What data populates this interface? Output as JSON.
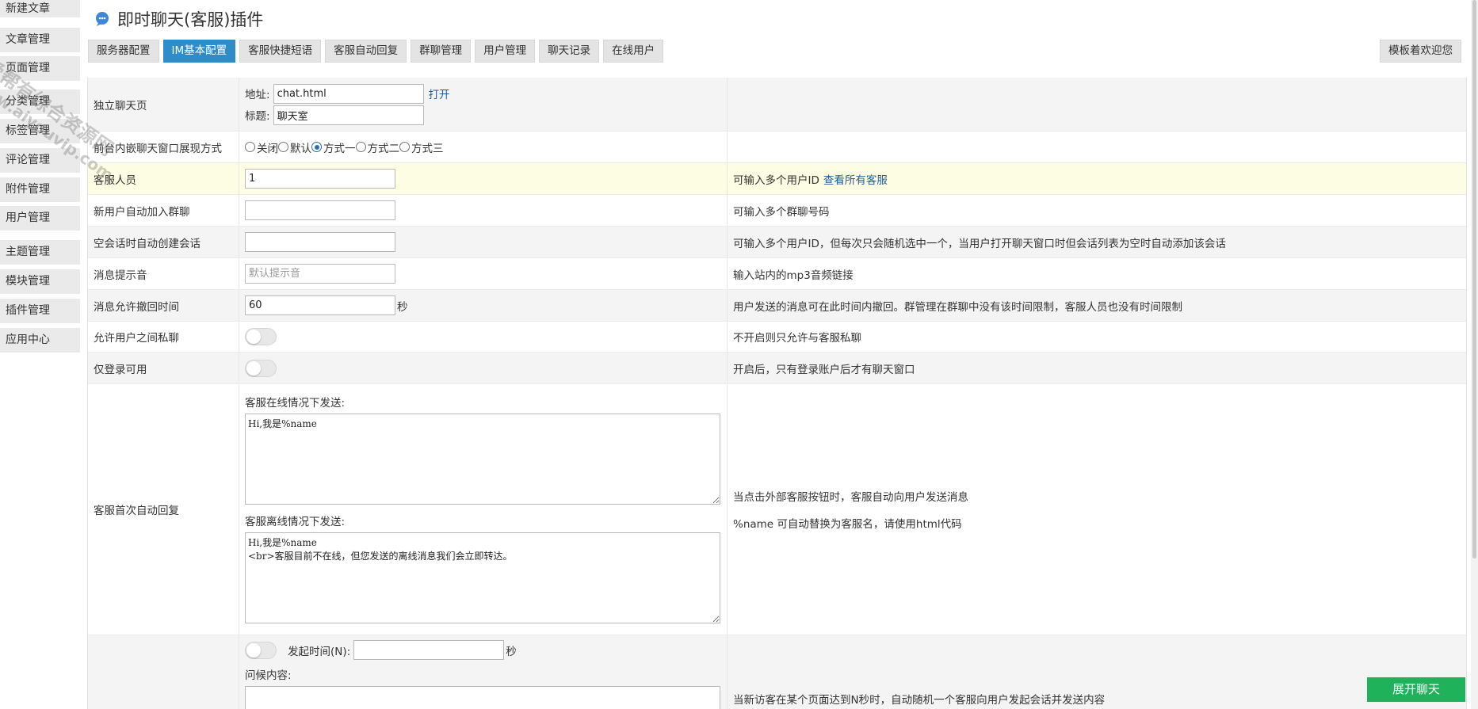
{
  "sidebar": {
    "items": [
      {
        "label": "新建文章"
      },
      {
        "label": "文章管理"
      },
      {
        "label": "页面管理"
      },
      {
        "label": "分类管理"
      },
      {
        "label": "标签管理"
      },
      {
        "label": "评论管理"
      },
      {
        "label": "附件管理"
      },
      {
        "label": "用户管理"
      },
      {
        "label": "主题管理"
      },
      {
        "label": "模块管理"
      },
      {
        "label": "插件管理"
      },
      {
        "label": "应用中心"
      }
    ]
  },
  "header": {
    "title": "即时聊天(客服)插件",
    "icon": "chat-bubble-icon"
  },
  "tabs": [
    {
      "label": "服务器配置",
      "active": false
    },
    {
      "label": "IM基本配置",
      "active": true
    },
    {
      "label": "客服快捷短语",
      "active": false
    },
    {
      "label": "客服自动回复",
      "active": false
    },
    {
      "label": "群聊管理",
      "active": false
    },
    {
      "label": "用户管理",
      "active": false
    },
    {
      "label": "聊天记录",
      "active": false
    },
    {
      "label": "在线用户",
      "active": false
    }
  ],
  "template_tab": "模板着欢迎您",
  "settings": {
    "standalone": {
      "label": "独立聊天页",
      "address_label": "地址:",
      "address_value": "chat.html",
      "open_link": "打开",
      "title_label": "标题:",
      "title_value": "聊天室"
    },
    "display_mode": {
      "label": "前台内嵌聊天窗口展现方式",
      "options": [
        "关闭",
        "默认",
        "方式一",
        "方式二",
        "方式三"
      ],
      "selected": "方式一"
    },
    "agents": {
      "label": "客服人员",
      "value": "1",
      "desc": "可输入多个用户ID",
      "desc_link": "查看所有客服"
    },
    "auto_join": {
      "label": "新用户自动加入群聊",
      "value": "",
      "desc": "可输入多个群聊号码"
    },
    "auto_session": {
      "label": "空会话时自动创建会话",
      "value": "",
      "desc": "可输入多个用户ID，但每次只会随机选中一个，当用户打开聊天窗口时但会话列表为空时自动添加该会话"
    },
    "sound": {
      "label": "消息提示音",
      "placeholder": "默认提示音",
      "desc": "输入站内的mp3音频链接"
    },
    "recall": {
      "label": "消息允许撤回时间",
      "value": "60",
      "unit": "秒",
      "desc": "用户发送的消息可在此时间内撤回。群管理在群聊中没有该时间限制，客服人员也没有时间限制"
    },
    "private_chat": {
      "label": "允许用户之间私聊",
      "enabled": false,
      "desc": "不开启则只允许与客服私聊"
    },
    "login_only": {
      "label": "仅登录可用",
      "enabled": false,
      "desc": "开启后，只有登录账户后才有聊天窗口"
    },
    "first_reply": {
      "label": "客服首次自动回复",
      "online_label": "客服在线情况下发送:",
      "online_text": "Hi,我是%name",
      "offline_label": "客服离线情况下发送:",
      "offline_text": "Hi,我是%name\n<br>客服目前不在线，但您发送的离线消息我们会立即转达。",
      "desc1": "当点击外部客服按钮时，客服自动向用户发送消息",
      "desc2": "%name 可自动替换为客服名，请使用html代码"
    },
    "greeting": {
      "enabled": false,
      "time_label": "发起时间(N):",
      "time_value": "",
      "unit": "秒",
      "content_label": "问候内容:",
      "desc": "当新访客在某个页面达到N秒时，自动随机一个客服向用户发起会话并发送内容"
    }
  },
  "chat_button": "展开聊天",
  "watermark": {
    "line1": "爱帮有综合资源网",
    "line2": "www.aiyouvip.com"
  },
  "colors": {
    "active_tab": "#2e8cc9",
    "highlight_row": "#fdfde3",
    "chat_button": "#1fb25a",
    "link": "#1f5d9a"
  }
}
